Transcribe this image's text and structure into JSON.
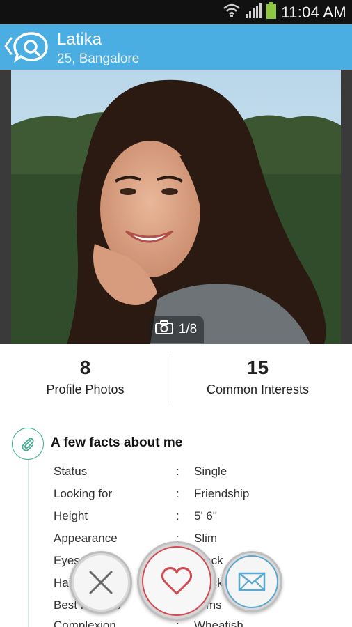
{
  "status_bar": {
    "time": "11:04 AM",
    "icons": [
      "wifi-icon",
      "signal-icon",
      "battery-icon"
    ]
  },
  "header": {
    "name": "Latika",
    "subtitle": "25, Bangalore",
    "accent_color": "#4aaee2"
  },
  "photo": {
    "counter": "1/8",
    "icon": "camera-icon"
  },
  "stats": [
    {
      "value": "8",
      "label": "Profile Photos"
    },
    {
      "value": "15",
      "label": "Common Interests"
    }
  ],
  "facts": {
    "title": "A few facts about me",
    "icon": "paperclip-icon",
    "rows": [
      {
        "label": "Status",
        "value": "Single"
      },
      {
        "label": "Looking for",
        "value": "Friendship"
      },
      {
        "label": "Height",
        "value": "5' 6\""
      },
      {
        "label": "Appearance",
        "value": "Slim"
      },
      {
        "label": "Eyes",
        "value": "Black"
      },
      {
        "label": "Hair",
        "value": "Black"
      },
      {
        "label": "Best Feature",
        "value": "Arms"
      },
      {
        "label": "Complexion",
        "value": "Wheatish"
      }
    ]
  },
  "actions": {
    "reject_icon": "close-icon",
    "like_icon": "heart-icon",
    "message_icon": "envelope-icon",
    "like_color": "#d24b52",
    "message_color": "#5aa7cf"
  }
}
